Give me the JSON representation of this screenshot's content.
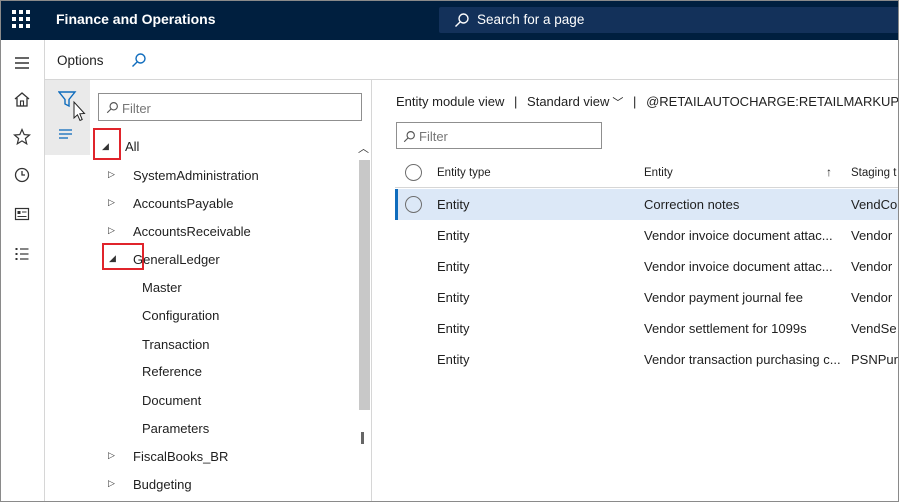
{
  "app": {
    "title": "Finance and Operations"
  },
  "search": {
    "label": "Search for a page"
  },
  "options": {
    "title": "Options"
  },
  "tree": {
    "filter_placeholder": "Filter",
    "root": "All",
    "items": [
      {
        "label": "SystemAdministration"
      },
      {
        "label": "AccountsPayable"
      },
      {
        "label": "AccountsReceivable"
      },
      {
        "label": "GeneralLedger"
      },
      {
        "label": "FiscalBooks_BR"
      },
      {
        "label": "Budgeting"
      }
    ],
    "children": [
      "Master",
      "Configuration",
      "Transaction",
      "Reference",
      "Document",
      "Parameters"
    ]
  },
  "main": {
    "crumbs": [
      "Entity module view",
      "|",
      "Standard view",
      "|",
      "@RETAILAUTOCHARGE:RETAILMARKUPAU"
    ],
    "filter_placeholder": "Filter",
    "columns": [
      "Entity type",
      "Entity",
      "Staging t"
    ],
    "sort_indicator": "↑",
    "rows": [
      {
        "type": "Entity",
        "entity": "Correction notes",
        "staging": "VendCo"
      },
      {
        "type": "Entity",
        "entity": "Vendor invoice document attac...",
        "staging": "Vendor"
      },
      {
        "type": "Entity",
        "entity": "Vendor invoice document attac...",
        "staging": "Vendor"
      },
      {
        "type": "Entity",
        "entity": "Vendor payment journal fee",
        "staging": "Vendor"
      },
      {
        "type": "Entity",
        "entity": "Vendor settlement for 1099s",
        "staging": "VendSe"
      },
      {
        "type": "Entity",
        "entity": "Vendor transaction purchasing c...",
        "staging": "PSNPur"
      }
    ]
  },
  "icons": {
    "rail": [
      "hamburger-icon",
      "home-icon",
      "star-icon",
      "clock-icon",
      "workspace-icon",
      "list-icon"
    ],
    "accent": "#0f6cbd",
    "topbar": "#001f3f",
    "highlight": "#e0242b"
  }
}
